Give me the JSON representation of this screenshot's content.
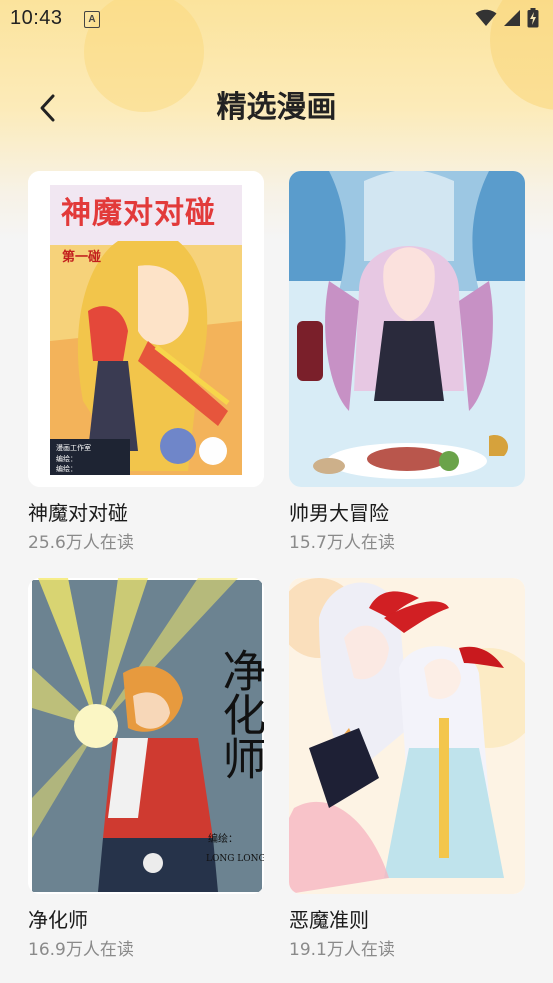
{
  "status_bar": {
    "time": "10:43",
    "notification_icon": "a-icon",
    "icons": [
      "wifi-icon",
      "cell-signal-icon",
      "battery-charging-icon"
    ]
  },
  "header": {
    "title": "精选漫画",
    "back_icon": "chevron-left-icon"
  },
  "comics": [
    {
      "title": "神魔对对碰",
      "readers": "25.6万人在读",
      "cover_text": "神魔对对碰",
      "cover_chapter": "第一碰",
      "cover_credits": [
        "漫画工作室",
        "编绘：",
        "编绘："
      ]
    },
    {
      "title": "帅男大冒险",
      "readers": "15.7万人在读"
    },
    {
      "title": "净化师",
      "readers": "16.9万人在读",
      "cover_text": "净化师",
      "cover_credit": "编绘：",
      "cover_author": "LONG LONG"
    },
    {
      "title": "恶魔准则",
      "readers": "19.1万人在读"
    }
  ],
  "colors": {
    "header_gradient_top": "#fbe39c",
    "background": "#f5f5f5",
    "subtitle": "#8a8a8a"
  }
}
